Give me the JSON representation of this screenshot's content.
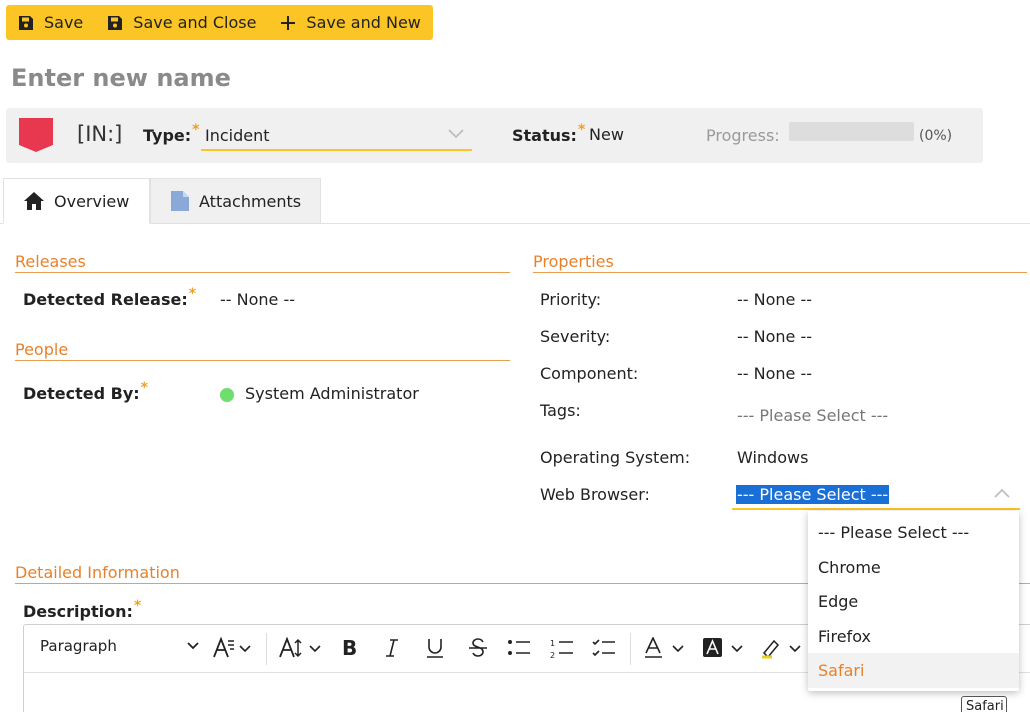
{
  "toolbar": {
    "save_label": "Save",
    "save_close_label": "Save and Close",
    "save_new_label": "Save and New"
  },
  "name_input": {
    "placeholder": "Enter new name",
    "value": ""
  },
  "info_bar": {
    "code": "[IN:]",
    "type_label": "Type:",
    "type_value": "Incident",
    "status_label": "Status:",
    "status_value": "New",
    "progress_label": "Progress:",
    "progress_percent_text": "(0%)",
    "progress_fraction": 0,
    "required_marker": "*",
    "flag_color": "#e8384f"
  },
  "tabs": [
    {
      "label": "Overview",
      "icon": "home-icon"
    },
    {
      "label": "Attachments",
      "icon": "document-icon"
    }
  ],
  "releases": {
    "title": "Releases",
    "detected_release_label": "Detected Release:",
    "detected_release_value": "-- None --"
  },
  "people": {
    "title": "People",
    "detected_by_label": "Detected By:",
    "detected_by_value": "System Administrator"
  },
  "properties": {
    "title": "Properties",
    "priority_label": "Priority:",
    "priority_value": "-- None --",
    "severity_label": "Severity:",
    "severity_value": "-- None --",
    "component_label": "Component:",
    "component_value": "-- None --",
    "tags_label": "Tags:",
    "tags_placeholder": "--- Please Select ---",
    "os_label": "Operating System:",
    "os_value": "Windows",
    "browser_label": "Web Browser:",
    "browser_value": "--- Please Select ---",
    "browser_options": [
      "--- Please Select ---",
      "Chrome",
      "Edge",
      "Firefox",
      "Safari"
    ],
    "browser_hovered": "Safari"
  },
  "detailed": {
    "title": "Detailed Information",
    "description_label": "Description:"
  },
  "editor": {
    "paragraph_label": "Paragraph"
  },
  "tooltip": {
    "text": "Safari"
  },
  "colors": {
    "accent": "#fbc525",
    "section": "#e8812a",
    "selection": "#1a6fd6"
  }
}
